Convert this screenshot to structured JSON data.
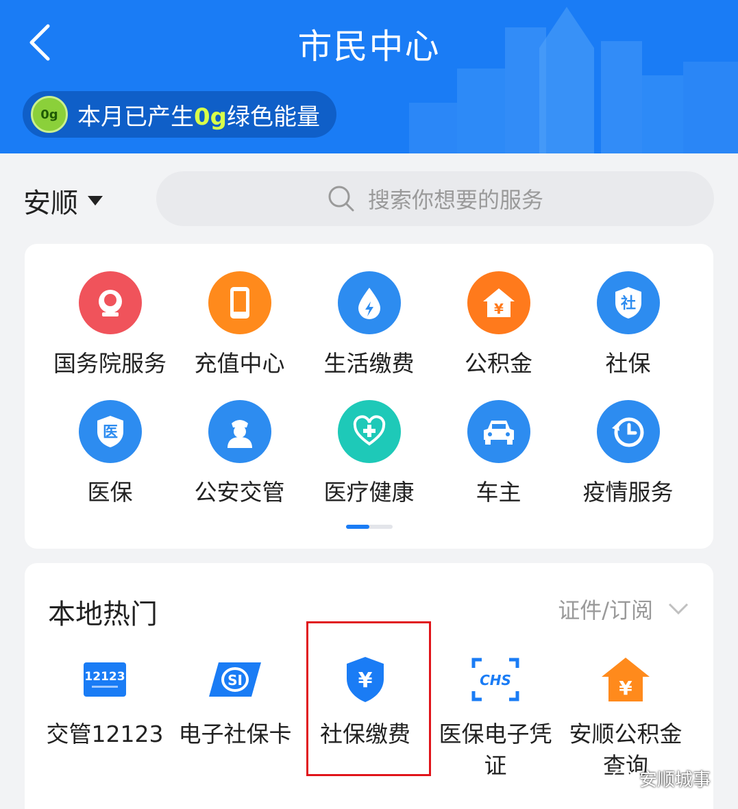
{
  "header": {
    "title": "市民中心",
    "energy_prefix": "本月已产生",
    "energy_value": "0g",
    "energy_suffix": "绿色能量",
    "energy_badge": "0g",
    "bg_color": "#1a7cf5"
  },
  "location": {
    "city": "安顺"
  },
  "search": {
    "placeholder": "搜索你想要的服务"
  },
  "services": {
    "rows": [
      [
        {
          "label": "国务院服务",
          "icon": "national-emblem-icon",
          "color": "#f0535b"
        },
        {
          "label": "充值中心",
          "icon": "phone-icon",
          "color": "#ff8a1c"
        },
        {
          "label": "生活缴费",
          "icon": "water-drop-icon",
          "color": "#2d8cf0"
        },
        {
          "label": "公积金",
          "icon": "house-yuan-icon",
          "color": "#ff7a1c"
        },
        {
          "label": "社保",
          "icon": "shield-she-icon",
          "color": "#2d8cf0"
        }
      ],
      [
        {
          "label": "医保",
          "icon": "shield-yi-icon",
          "color": "#2d8cf0"
        },
        {
          "label": "公安交管",
          "icon": "police-icon",
          "color": "#2d8cf0"
        },
        {
          "label": "医疗健康",
          "icon": "stethoscope-heart-icon",
          "color": "#1ec9b8"
        },
        {
          "label": "车主",
          "icon": "car-icon",
          "color": "#2d8cf0"
        },
        {
          "label": "疫情服务",
          "icon": "clock-history-icon",
          "color": "#2d8cf0"
        }
      ]
    ]
  },
  "local_hot": {
    "title": "本地热门",
    "subscribe_label": "证件/订阅",
    "items": [
      {
        "label": "交管12123",
        "icon": "traffic-12123-icon",
        "icon_text": "12123"
      },
      {
        "label": "电子社保卡",
        "icon": "social-security-card-icon",
        "icon_text": "SI"
      },
      {
        "label": "社保缴费",
        "icon": "shield-yuan-icon",
        "icon_text": "¥"
      },
      {
        "label": "医保电子凭证",
        "icon": "chs-scan-icon",
        "icon_text": "CHS"
      },
      {
        "label": "安顺公积金查询",
        "icon": "house-yuan-orange-icon",
        "icon_text": "¥"
      }
    ]
  },
  "watermark": {
    "text": "安顺城事"
  }
}
